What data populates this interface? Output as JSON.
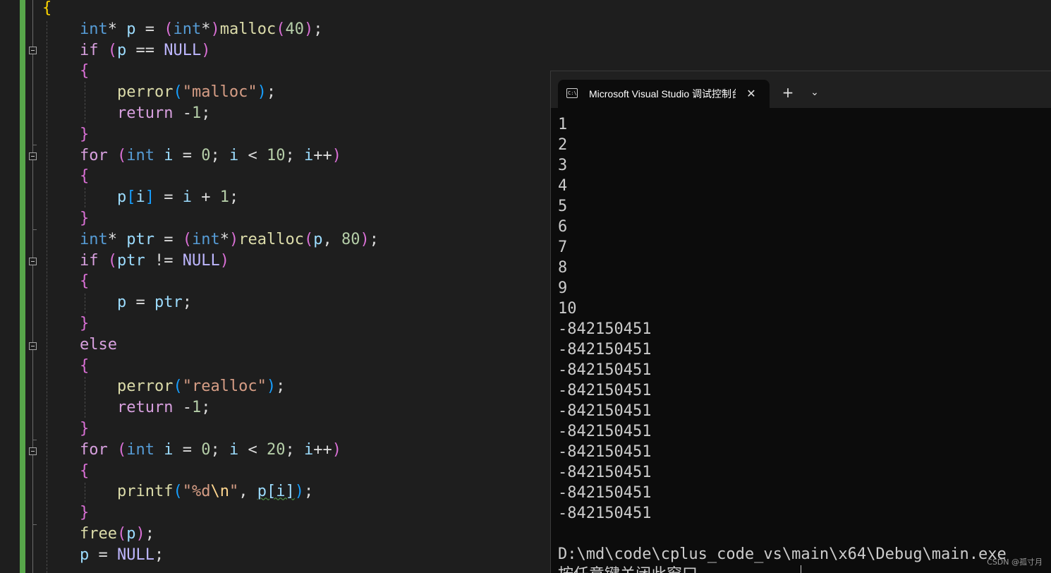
{
  "editor": {
    "lines": [
      {
        "tokens": [
          {
            "t": "{",
            "c": "p1"
          }
        ]
      },
      {
        "tokens": [
          {
            "t": "    "
          },
          {
            "t": "int",
            "c": "kw"
          },
          {
            "t": "* "
          },
          {
            "t": "p",
            "c": "var"
          },
          {
            "t": " = "
          },
          {
            "t": "(",
            "c": "p2"
          },
          {
            "t": "int",
            "c": "kw"
          },
          {
            "t": "*"
          },
          {
            "t": ")",
            "c": "p2"
          },
          {
            "t": "malloc",
            "c": "fn"
          },
          {
            "t": "(",
            "c": "p2"
          },
          {
            "t": "40",
            "c": "num"
          },
          {
            "t": ")",
            "c": "p2"
          },
          {
            "t": ";"
          }
        ]
      },
      {
        "tokens": [
          {
            "t": "    "
          },
          {
            "t": "if",
            "c": "ctl"
          },
          {
            "t": " "
          },
          {
            "t": "(",
            "c": "p2"
          },
          {
            "t": "p",
            "c": "var"
          },
          {
            "t": " == "
          },
          {
            "t": "NULL",
            "c": "mac"
          },
          {
            "t": ")",
            "c": "p2"
          }
        ]
      },
      {
        "tokens": [
          {
            "t": "    "
          },
          {
            "t": "{",
            "c": "p2"
          }
        ]
      },
      {
        "tokens": [
          {
            "t": "        "
          },
          {
            "t": "perror",
            "c": "fn"
          },
          {
            "t": "(",
            "c": "p3"
          },
          {
            "t": "\"malloc\"",
            "c": "str"
          },
          {
            "t": ")",
            "c": "p3"
          },
          {
            "t": ";"
          }
        ]
      },
      {
        "tokens": [
          {
            "t": "        "
          },
          {
            "t": "return",
            "c": "ctl"
          },
          {
            "t": " -"
          },
          {
            "t": "1",
            "c": "num"
          },
          {
            "t": ";"
          }
        ]
      },
      {
        "tokens": [
          {
            "t": "    "
          },
          {
            "t": "}",
            "c": "p2"
          }
        ]
      },
      {
        "tokens": [
          {
            "t": "    "
          },
          {
            "t": "for",
            "c": "ctl"
          },
          {
            "t": " "
          },
          {
            "t": "(",
            "c": "p2"
          },
          {
            "t": "int",
            "c": "kw"
          },
          {
            "t": " "
          },
          {
            "t": "i",
            "c": "var"
          },
          {
            "t": " = "
          },
          {
            "t": "0",
            "c": "num"
          },
          {
            "t": "; "
          },
          {
            "t": "i",
            "c": "var"
          },
          {
            "t": " < "
          },
          {
            "t": "10",
            "c": "num"
          },
          {
            "t": "; "
          },
          {
            "t": "i",
            "c": "var"
          },
          {
            "t": "++"
          },
          {
            "t": ")",
            "c": "p2"
          }
        ]
      },
      {
        "tokens": [
          {
            "t": "    "
          },
          {
            "t": "{",
            "c": "p2"
          }
        ]
      },
      {
        "tokens": [
          {
            "t": "        "
          },
          {
            "t": "p",
            "c": "var"
          },
          {
            "t": "[",
            "c": "p3"
          },
          {
            "t": "i",
            "c": "var"
          },
          {
            "t": "]",
            "c": "p3"
          },
          {
            "t": " = "
          },
          {
            "t": "i",
            "c": "var"
          },
          {
            "t": " + "
          },
          {
            "t": "1",
            "c": "num"
          },
          {
            "t": ";"
          }
        ]
      },
      {
        "tokens": [
          {
            "t": "    "
          },
          {
            "t": "}",
            "c": "p2"
          }
        ]
      },
      {
        "tokens": [
          {
            "t": "    "
          },
          {
            "t": "int",
            "c": "kw"
          },
          {
            "t": "* "
          },
          {
            "t": "ptr",
            "c": "var"
          },
          {
            "t": " = "
          },
          {
            "t": "(",
            "c": "p2"
          },
          {
            "t": "int",
            "c": "kw"
          },
          {
            "t": "*"
          },
          {
            "t": ")",
            "c": "p2"
          },
          {
            "t": "realloc",
            "c": "fn"
          },
          {
            "t": "(",
            "c": "p2"
          },
          {
            "t": "p",
            "c": "var"
          },
          {
            "t": ", "
          },
          {
            "t": "80",
            "c": "num"
          },
          {
            "t": ")",
            "c": "p2"
          },
          {
            "t": ";"
          }
        ]
      },
      {
        "tokens": [
          {
            "t": "    "
          },
          {
            "t": "if",
            "c": "ctl"
          },
          {
            "t": " "
          },
          {
            "t": "(",
            "c": "p2"
          },
          {
            "t": "ptr",
            "c": "var"
          },
          {
            "t": " != "
          },
          {
            "t": "NULL",
            "c": "mac"
          },
          {
            "t": ")",
            "c": "p2"
          }
        ]
      },
      {
        "tokens": [
          {
            "t": "    "
          },
          {
            "t": "{",
            "c": "p2"
          }
        ]
      },
      {
        "tokens": [
          {
            "t": "        "
          },
          {
            "t": "p",
            "c": "var"
          },
          {
            "t": " = "
          },
          {
            "t": "ptr",
            "c": "var"
          },
          {
            "t": ";"
          }
        ]
      },
      {
        "tokens": [
          {
            "t": "    "
          },
          {
            "t": "}",
            "c": "p2"
          }
        ]
      },
      {
        "tokens": [
          {
            "t": "    "
          },
          {
            "t": "else",
            "c": "ctl"
          }
        ]
      },
      {
        "tokens": [
          {
            "t": "    "
          },
          {
            "t": "{",
            "c": "p2"
          }
        ]
      },
      {
        "tokens": [
          {
            "t": "        "
          },
          {
            "t": "perror",
            "c": "fn"
          },
          {
            "t": "(",
            "c": "p3"
          },
          {
            "t": "\"realloc\"",
            "c": "str"
          },
          {
            "t": ")",
            "c": "p3"
          },
          {
            "t": ";"
          }
        ]
      },
      {
        "tokens": [
          {
            "t": "        "
          },
          {
            "t": "return",
            "c": "ctl"
          },
          {
            "t": " -"
          },
          {
            "t": "1",
            "c": "num"
          },
          {
            "t": ";"
          }
        ]
      },
      {
        "tokens": [
          {
            "t": "    "
          },
          {
            "t": "}",
            "c": "p2"
          }
        ]
      },
      {
        "tokens": [
          {
            "t": "    "
          },
          {
            "t": "for",
            "c": "ctl"
          },
          {
            "t": " "
          },
          {
            "t": "(",
            "c": "p2"
          },
          {
            "t": "int",
            "c": "kw"
          },
          {
            "t": " "
          },
          {
            "t": "i",
            "c": "var"
          },
          {
            "t": " = "
          },
          {
            "t": "0",
            "c": "num"
          },
          {
            "t": "; "
          },
          {
            "t": "i",
            "c": "var"
          },
          {
            "t": " < "
          },
          {
            "t": "20",
            "c": "num"
          },
          {
            "t": "; "
          },
          {
            "t": "i",
            "c": "var"
          },
          {
            "t": "++"
          },
          {
            "t": ")",
            "c": "p2"
          }
        ]
      },
      {
        "tokens": [
          {
            "t": "    "
          },
          {
            "t": "{",
            "c": "p2"
          }
        ]
      },
      {
        "tokens": [
          {
            "t": "        "
          },
          {
            "t": "printf",
            "c": "fn"
          },
          {
            "t": "(",
            "c": "p3"
          },
          {
            "t": "\"%d",
            "c": "str"
          },
          {
            "t": "\\n",
            "c": "esc"
          },
          {
            "t": "\"",
            "c": "str"
          },
          {
            "t": ", "
          },
          {
            "t": "p[i]",
            "c": "var squig"
          },
          {
            "t": ")",
            "c": "p3"
          },
          {
            "t": ";"
          }
        ]
      },
      {
        "tokens": [
          {
            "t": "    "
          },
          {
            "t": "}",
            "c": "p2"
          }
        ]
      },
      {
        "tokens": [
          {
            "t": "    "
          },
          {
            "t": "free",
            "c": "fn"
          },
          {
            "t": "(",
            "c": "p2"
          },
          {
            "t": "p",
            "c": "var"
          },
          {
            "t": ")",
            "c": "p2"
          },
          {
            "t": ";"
          }
        ]
      },
      {
        "tokens": [
          {
            "t": "    "
          },
          {
            "t": "p",
            "c": "var"
          },
          {
            "t": " = "
          },
          {
            "t": "NULL",
            "c": "mac"
          },
          {
            "t": ";"
          }
        ]
      }
    ]
  },
  "terminal": {
    "tab_title": "Microsoft Visual Studio 调试控制台",
    "tab_icon_text": "C:\\",
    "close_symbol": "✕",
    "new_tab_symbol": "+",
    "dropdown_symbol": "⌄",
    "output_lines": [
      "1",
      "2",
      "3",
      "4",
      "5",
      "6",
      "7",
      "8",
      "9",
      "10",
      "-842150451",
      "-842150451",
      "-842150451",
      "-842150451",
      "-842150451",
      "-842150451",
      "-842150451",
      "-842150451",
      "-842150451",
      "-842150451",
      "",
      "D:\\md\\code\\cplus_code_vs\\main\\x64\\Debug\\main.exe",
      "按任意键关闭此窗口..."
    ]
  },
  "watermark": "CSDN @孤寸月",
  "colors": {
    "editor_bg": "#1e1e1e",
    "change_bar": "#57a64a",
    "terminal_bg": "#0c0c0c",
    "titlebar_bg": "#202020"
  }
}
